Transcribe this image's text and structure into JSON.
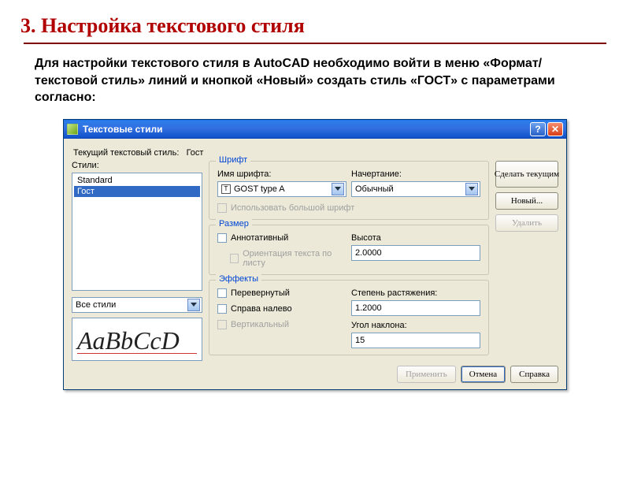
{
  "slide": {
    "heading": "3. Настройка текстового стиля",
    "body": "Для настройки текстового стиля в AutoCAD необходимо войти в меню «Формат/текстовой стиль» линий и кнопкой «Новый» создать стиль «ГОСТ» с параметрами согласно:"
  },
  "dialog": {
    "title": "Текстовые стили",
    "current_label": "Текущий текстовый стиль:",
    "current_value": "Гост",
    "styles_label": "Стили:",
    "styles_list": [
      "Standard",
      "Гост"
    ],
    "styles_selected": "Гост",
    "filter": "Все стили",
    "preview_text": "AaBbCcD",
    "font_group": "Шрифт",
    "font_name_label": "Имя шрифта:",
    "font_name_value": "GOST type A",
    "font_style_label": "Начертание:",
    "font_style_value": "Обычный",
    "big_font_label": "Использовать большой шрифт",
    "size_group": "Размер",
    "annotative_label": "Аннотативный",
    "orient_label": "Ориентация текста по листу",
    "height_label": "Высота",
    "height_value": "2.0000",
    "effects_group": "Эффекты",
    "upside_label": "Перевернутый",
    "rtl_label": "Справа налево",
    "vertical_label": "Вертикальный",
    "width_label": "Степень растяжения:",
    "width_value": "1.2000",
    "oblique_label": "Угол наклона:",
    "oblique_value": "15",
    "buttons": {
      "set_current": "Сделать текущим",
      "new": "Новый...",
      "delete": "Удалить",
      "apply": "Применить",
      "cancel": "Отмена",
      "help": "Справка"
    }
  }
}
